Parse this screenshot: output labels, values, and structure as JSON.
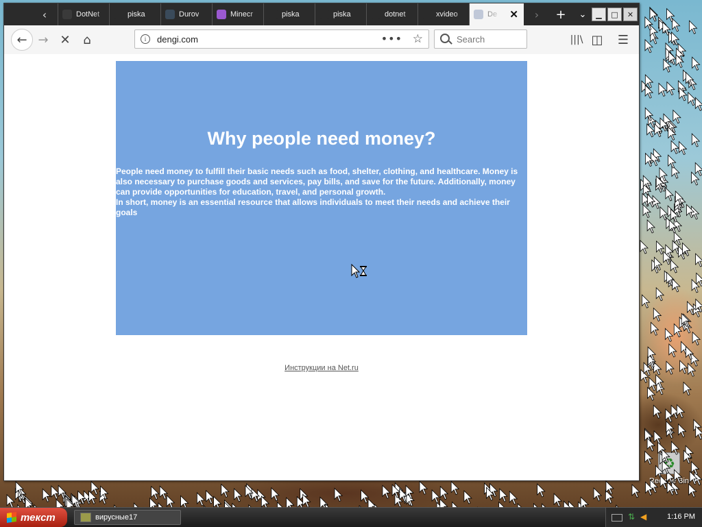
{
  "browser": {
    "tabs": [
      {
        "title": "DotNet",
        "favicon_color": "#3a3a3a"
      },
      {
        "title": "piska",
        "favicon_color": "#2b2b2b"
      },
      {
        "title": "Durov",
        "favicon_color": "#3a4a5a"
      },
      {
        "title": "Minecr",
        "favicon_color": "#9b59d0"
      },
      {
        "title": "piska",
        "favicon_color": "#2b2b2b"
      },
      {
        "title": "piska",
        "favicon_color": "#2b2b2b"
      },
      {
        "title": "dotnet",
        "favicon_color": "#2b2b2b"
      },
      {
        "title": "xvideo",
        "favicon_color": "#2b2b2b"
      },
      {
        "title": "De",
        "favicon_color": "#c0c8d8",
        "active": true
      }
    ],
    "url": "dengi.com",
    "search_placeholder": "Search",
    "accent_color": "#2b2b2b"
  },
  "page": {
    "heading": "Why people need money?",
    "paragraph1": "People need money to fulfill their basic needs such as food, shelter, clothing, and healthcare. Money is also necessary to purchase goods and services, pay bills, and save for the future. Additionally, money can provide opportunities for education, travel, and personal growth.",
    "paragraph2": "In short, money is an essential resource that allows individuals to meet their needs and achieve their goals",
    "hero_color": "#76a5e0",
    "footer_link": "Инструкции на Net.ru"
  },
  "desktop": {
    "recycle_bin_label": "Recycle Bin"
  },
  "taskbar": {
    "start_label": "текст",
    "task_label": "вирусные17",
    "clock": "1:16 PM"
  }
}
